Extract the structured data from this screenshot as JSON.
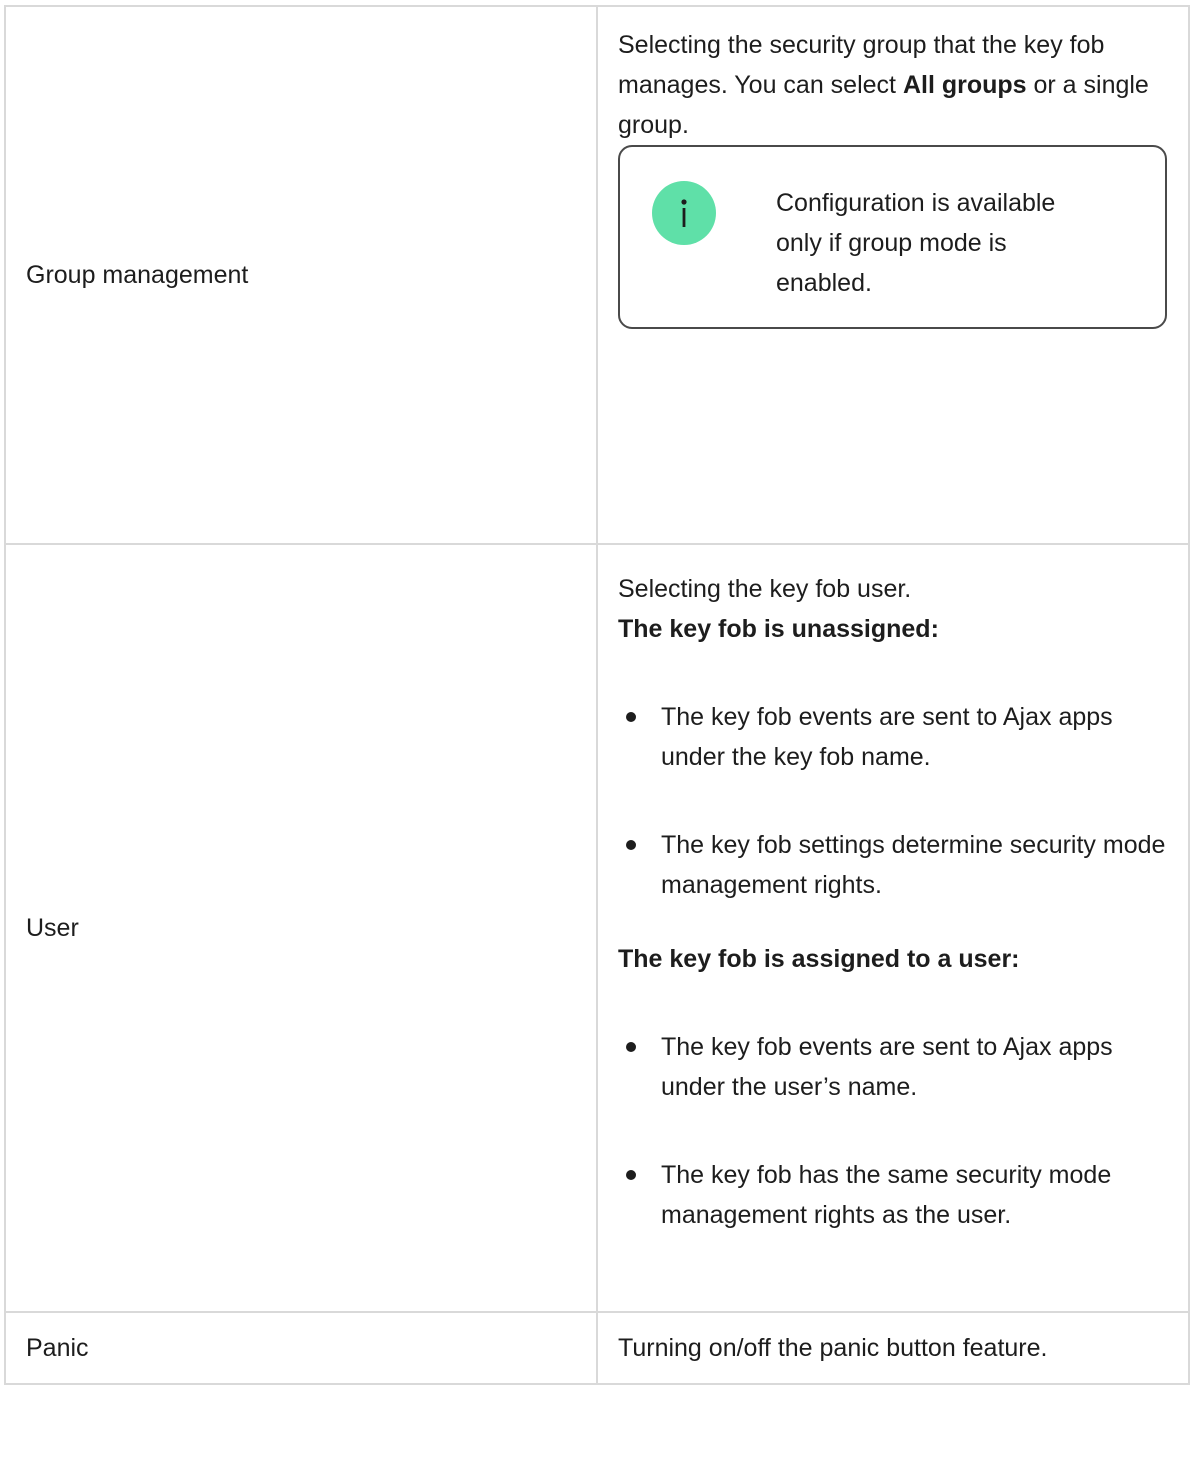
{
  "rows": {
    "group": {
      "name": "Group management",
      "desc_before": "Selecting the security group that the key fob manages. You can select ",
      "desc_bold": "All groups",
      "desc_after": " or a single group.",
      "note": "Configuration is available only if group mode is enabled."
    },
    "user": {
      "name": "User",
      "intro": "Selecting the key fob user.",
      "heading_unassigned": "The key fob is unassigned:",
      "unassigned_items": [
        "The key fob events are sent to Ajax apps under the key fob name.",
        "The key fob settings determine security mode management rights."
      ],
      "heading_assigned": "The key fob is assigned to a user:",
      "assigned_items": [
        "The key fob events are sent to Ajax apps under the user’s name.",
        "The key fob has the same security mode management rights as the user."
      ]
    },
    "panic": {
      "name": "Panic",
      "desc": "Turning on/off the panic button feature."
    }
  },
  "icons": {
    "note_icon": "info-icon"
  },
  "colors": {
    "info_icon_bg": "#5fe0a8",
    "border": "#d9d9d9",
    "text": "#1d1d1d"
  }
}
